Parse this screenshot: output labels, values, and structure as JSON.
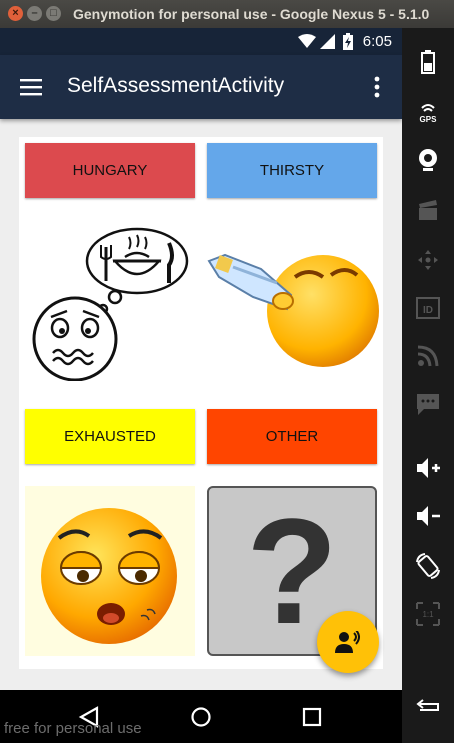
{
  "window": {
    "title": "Genymotion for personal use - Google Nexus 5 - 5.1.0",
    "close_glyph": "×",
    "min_glyph": "–",
    "max_glyph": "□"
  },
  "status_bar": {
    "time": "6:05"
  },
  "app_bar": {
    "title": "SelfAssessmentActivity"
  },
  "options": [
    {
      "label": "HUNGARY",
      "color": "#dc4a4e"
    },
    {
      "label": "THIRSTY",
      "color": "#64a7ea"
    },
    {
      "label": "EXHAUSTED",
      "color": "#ffff00"
    },
    {
      "label": "OTHER",
      "color": "#ff4500"
    }
  ],
  "other_image": {
    "glyph": "?"
  },
  "side_panel": {
    "id_label": "ID",
    "ratio_label": "1:1"
  },
  "watermark": "free for personal use",
  "colors": {
    "app_bar": "#1e2d45",
    "status_bar": "#172438",
    "fab": "#ffc107"
  }
}
